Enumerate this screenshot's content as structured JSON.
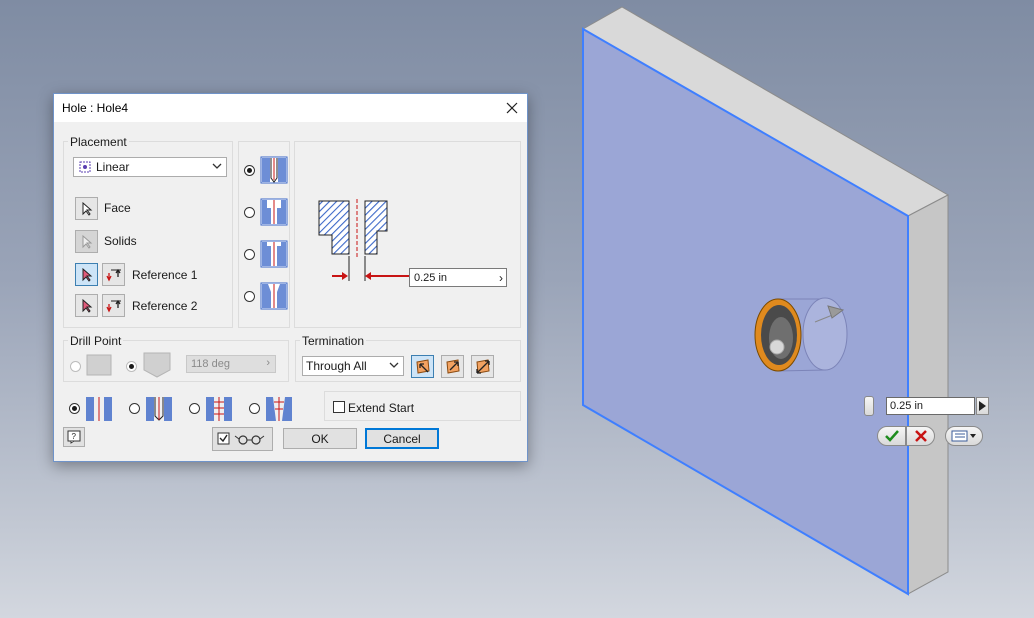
{
  "dialog": {
    "title": "Hole : Hole4",
    "placement": {
      "label": "Placement",
      "type_value": "Linear",
      "selectors": [
        {
          "label": "Face"
        },
        {
          "label": "Solids"
        },
        {
          "label": "Reference 1"
        },
        {
          "label": "Reference 2"
        }
      ]
    },
    "preview": {
      "distance_value": "0.25 in"
    },
    "drill_point": {
      "label": "Drill Point",
      "angle_value": "118 deg"
    },
    "termination": {
      "label": "Termination",
      "value": "Through All"
    },
    "extend_start_label": "Extend Start",
    "ok_label": "OK",
    "cancel_label": "Cancel"
  },
  "mini_toolbar": {
    "distance_value": "0.25 in"
  },
  "colors": {
    "plate_face": "#9ba6d6",
    "plate_side": "#c9c9c9",
    "plate_top": "#d9d9d9",
    "edge_highlight": "#3f7fff",
    "hole_ring": "#e08a1e",
    "hatch": "#3c68c8",
    "arrow_red": "#d01010",
    "ok_green": "#1e8c1e",
    "cancel_red": "#c81414"
  }
}
